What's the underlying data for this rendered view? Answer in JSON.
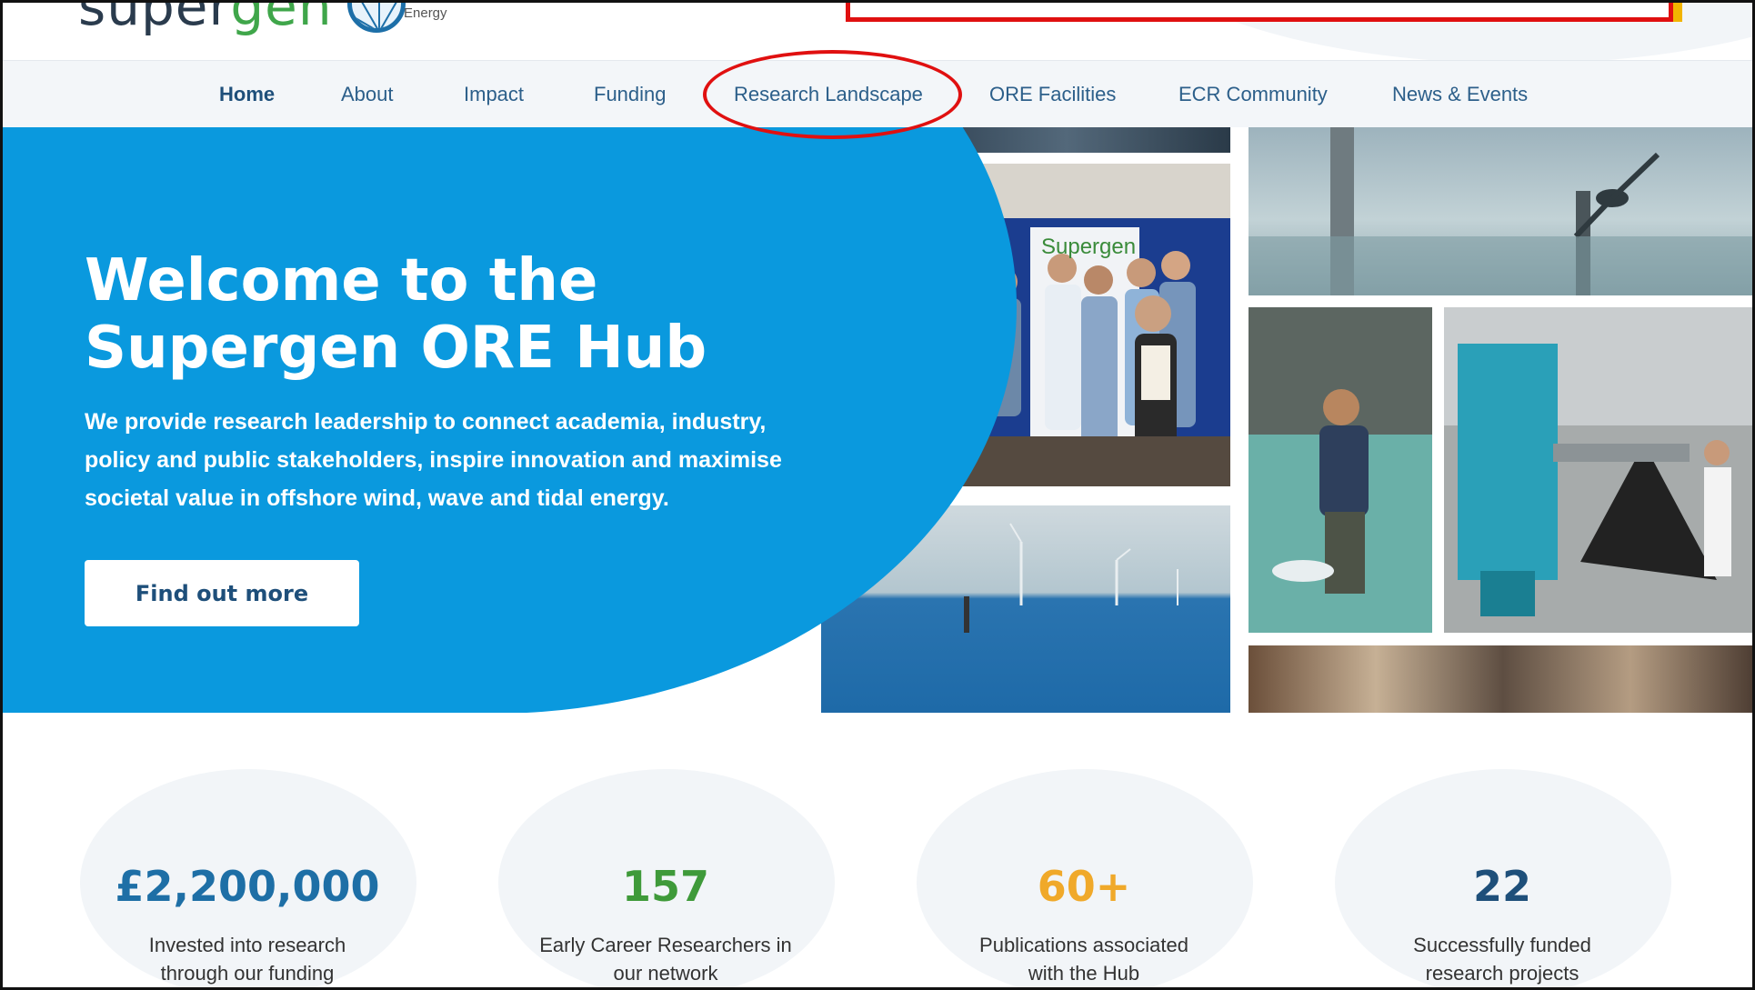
{
  "logo": {
    "word_a": "super",
    "word_b": "gen",
    "sub": "Energy",
    "icon": "supergen-logo-mark"
  },
  "nav": {
    "items": [
      {
        "label": "Home",
        "active": true
      },
      {
        "label": "About"
      },
      {
        "label": "Impact"
      },
      {
        "label": "Funding"
      },
      {
        "label": "Research Landscape",
        "highlighted": true
      },
      {
        "label": "ORE Facilities"
      },
      {
        "label": "ECR Community"
      },
      {
        "label": "News & Events"
      }
    ]
  },
  "hero": {
    "title": "Welcome to the\nSupergen ORE Hub",
    "text": "We provide research leadership to connect academia, industry, policy and public stakeholders, inspire innovation and maximise societal value in offshore wind, wave and tidal energy.",
    "button": "Find out more",
    "photo_sign": "Supergen"
  },
  "stats": [
    {
      "value": "£2,200,000",
      "label": "Invested into research through our funding",
      "color": "#1e6fa6"
    },
    {
      "value": "157",
      "label": "Early Career Researchers in our network",
      "color": "#3f9a3a"
    },
    {
      "value": "60+",
      "label": "Publications associated with the Hub",
      "color": "#f0a92a"
    },
    {
      "value": "22",
      "label": "Successfully funded research projects",
      "color": "#1e4f7a"
    }
  ],
  "colors": {
    "hero_blue": "#0a99de",
    "nav_bg": "#f3f6f9",
    "annotation": "#e01010",
    "nav_text": "#2c5f8a"
  }
}
